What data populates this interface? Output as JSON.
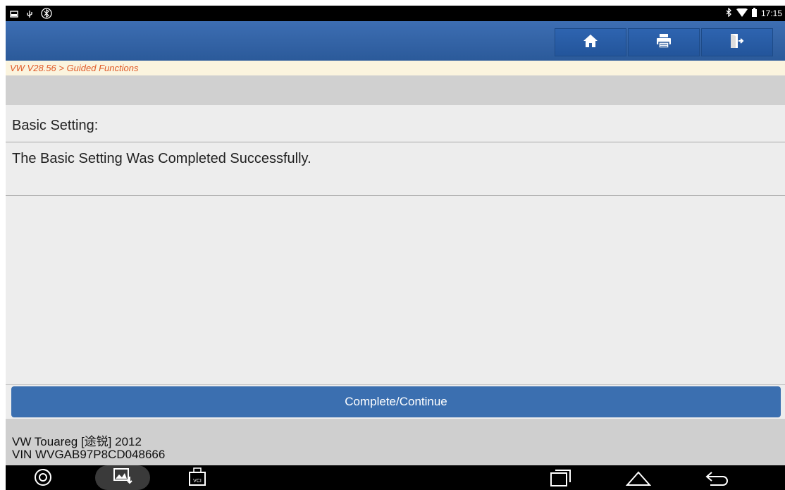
{
  "status_bar": {
    "time": "17:15",
    "left_icons": [
      "screenshot-icon",
      "usb-icon",
      "vci-bluetooth-icon"
    ],
    "right_icons": [
      "bluetooth-icon",
      "wifi-icon",
      "battery-icon"
    ]
  },
  "header": {
    "buttons": [
      {
        "name": "home-button",
        "icon": "home-icon"
      },
      {
        "name": "print-button",
        "icon": "printer-icon"
      },
      {
        "name": "exit-button",
        "icon": "exit-icon"
      }
    ]
  },
  "breadcrumb": "VW V28.56 > Guided Functions",
  "content": {
    "title": "Basic Setting:",
    "message": "The Basic Setting Was Completed Successfully."
  },
  "action_button": "Complete/Continue",
  "vehicle": {
    "model": "VW Touareg [途锐] 2012",
    "vin": "VIN WVGAB97P8CD048666"
  },
  "nav_bar": {
    "vci_label": "VCI",
    "items": [
      "browser-icon",
      "gallery-icon",
      "vci-icon",
      "recent-apps-icon",
      "home-nav-icon",
      "back-icon"
    ]
  },
  "colors": {
    "header_blue": "#2f62a7",
    "breadcrumb_text": "#e05a28",
    "action_blue": "#3b6fb0"
  }
}
